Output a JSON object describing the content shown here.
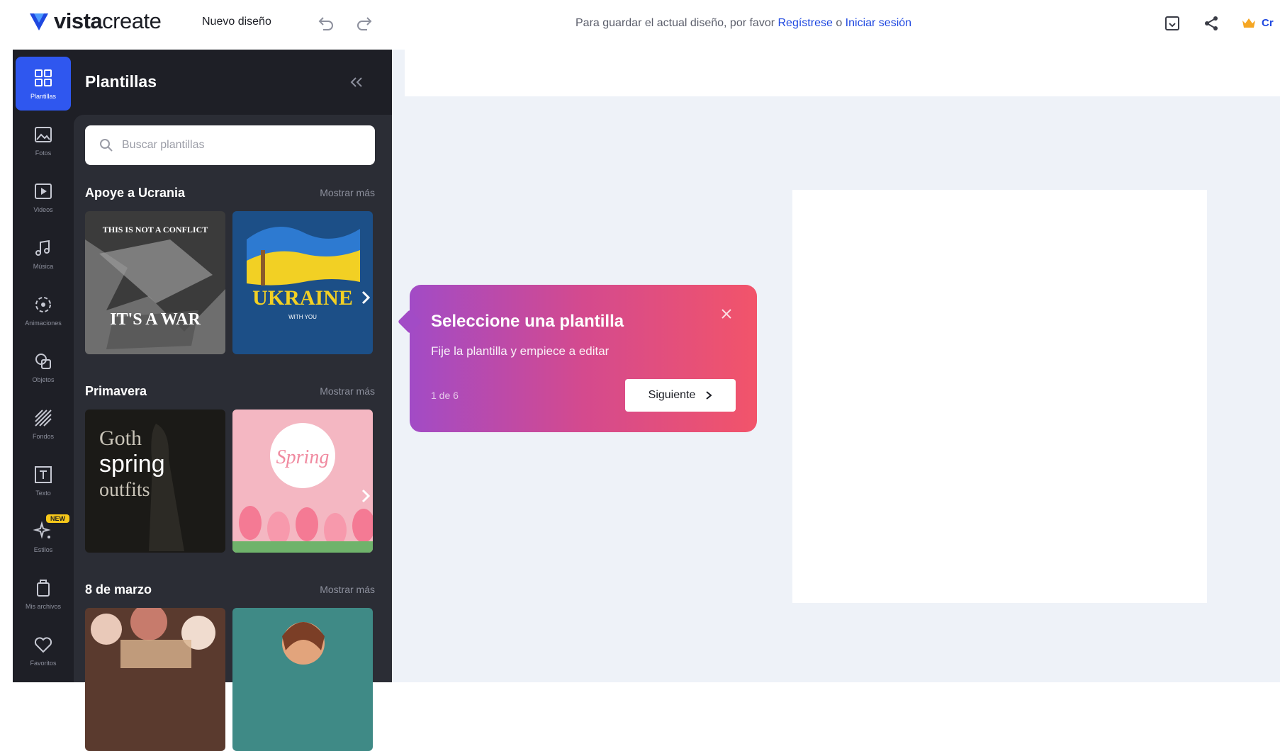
{
  "app": {
    "logo_bold": "vista",
    "logo_regular": "create",
    "new_design": "Nuevo diseño",
    "save_prefix": "Para guardar el actual diseño, por favor ",
    "register_link": "Regístrese",
    "save_or": " o ",
    "login_link": "Iniciar sesión",
    "cr_label": "Cr"
  },
  "rail": {
    "items": [
      {
        "label": "Plantillas",
        "icon": "templates-icon"
      },
      {
        "label": "Fotos",
        "icon": "photos-icon"
      },
      {
        "label": "Videos",
        "icon": "videos-icon"
      },
      {
        "label": "Música",
        "icon": "music-icon"
      },
      {
        "label": "Animaciones",
        "icon": "animations-icon"
      },
      {
        "label": "Objetos",
        "icon": "objects-icon"
      },
      {
        "label": "Fondos",
        "icon": "backgrounds-icon"
      },
      {
        "label": "Texto",
        "icon": "text-icon"
      },
      {
        "label": "Estilos",
        "icon": "styles-icon"
      },
      {
        "label": "Mis archivos",
        "icon": "my-files-icon"
      },
      {
        "label": "Favoritos",
        "icon": "favorites-icon"
      }
    ],
    "new_badge": "NEW"
  },
  "panel": {
    "title": "Plantillas",
    "search_placeholder": "Buscar plantillas",
    "sections": [
      {
        "title": "Apoye a Ucrania",
        "more": "Mostrar más",
        "thumb1_text_top": "THIS IS NOT A CONFLICT",
        "thumb1_text_bottom": "IT'S A WAR",
        "thumb2_text": "UKRAINE",
        "thumb2_sub": "WITH YOU"
      },
      {
        "title": "Primavera",
        "more": "Mostrar más",
        "thumb1_line1": "Goth",
        "thumb1_line2": "spring",
        "thumb1_line3": "outfits",
        "thumb2_text": "Spring"
      },
      {
        "title": "8 de marzo",
        "more": "Mostrar más"
      }
    ]
  },
  "tooltip": {
    "title": "Seleccione una plantilla",
    "subtitle": "Fije la plantilla y empiece a editar",
    "step": "1 de 6",
    "next_label": "Siguiente"
  },
  "colors": {
    "accent": "#2f57ef",
    "panel_bg": "#1e1f26",
    "canvas_bg": "#eef2f8",
    "tooltip_start": "#a24bc6",
    "tooltip_end": "#f2546a"
  }
}
